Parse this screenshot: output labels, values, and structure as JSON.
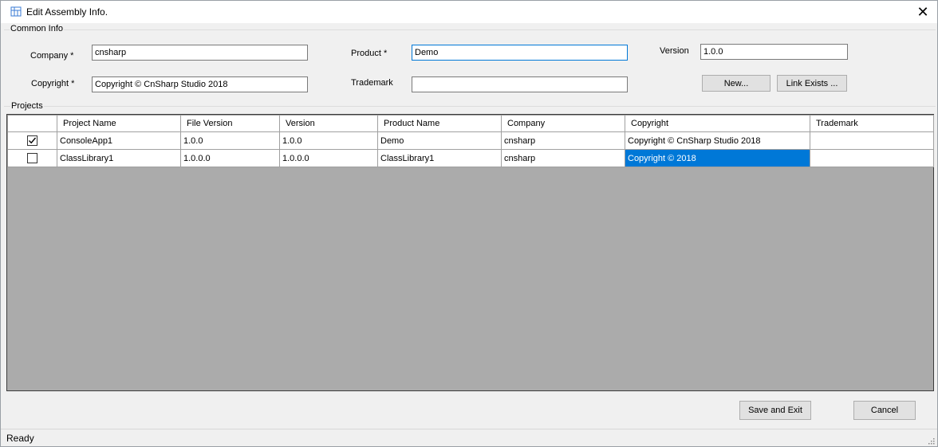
{
  "window": {
    "title": "Edit Assembly Info.",
    "close_label": "✕"
  },
  "common_info": {
    "group_label": "Common Info",
    "company_label": "Company *",
    "company_value": "cnsharp",
    "product_label": "Product *",
    "product_value": "Demo",
    "version_label": "Version",
    "version_value": "1.0.0",
    "copyright_label": "Copyright *",
    "copyright_value": "Copyright © CnSharp Studio 2018",
    "trademark_label": "Trademark",
    "trademark_value": "",
    "new_button": "New...",
    "link_exists_button": "Link Exists ..."
  },
  "projects": {
    "group_label": "Projects",
    "columns": [
      "",
      "Project Name",
      "File Version",
      "Version",
      "Product Name",
      "Company",
      "Copyright",
      "Trademark"
    ],
    "rows": [
      {
        "checked": true,
        "project_name": "ConsoleApp1",
        "file_version": "1.0.0",
        "version": "1.0.0",
        "product_name": "Demo",
        "company": "cnsharp",
        "copyright": "Copyright © CnSharp Studio 2018",
        "trademark": ""
      },
      {
        "checked": false,
        "project_name": "ClassLibrary1",
        "file_version": "1.0.0.0",
        "version": "1.0.0.0",
        "product_name": "ClassLibrary1",
        "company": "cnsharp",
        "copyright": "Copyright © 2018",
        "trademark": ""
      }
    ]
  },
  "actions": {
    "save_exit": "Save and Exit",
    "cancel": "Cancel"
  },
  "status": {
    "text": "Ready"
  },
  "colors": {
    "selection": "#0078d7",
    "grid_background": "#ababab",
    "window_background": "#f0f0f0"
  }
}
